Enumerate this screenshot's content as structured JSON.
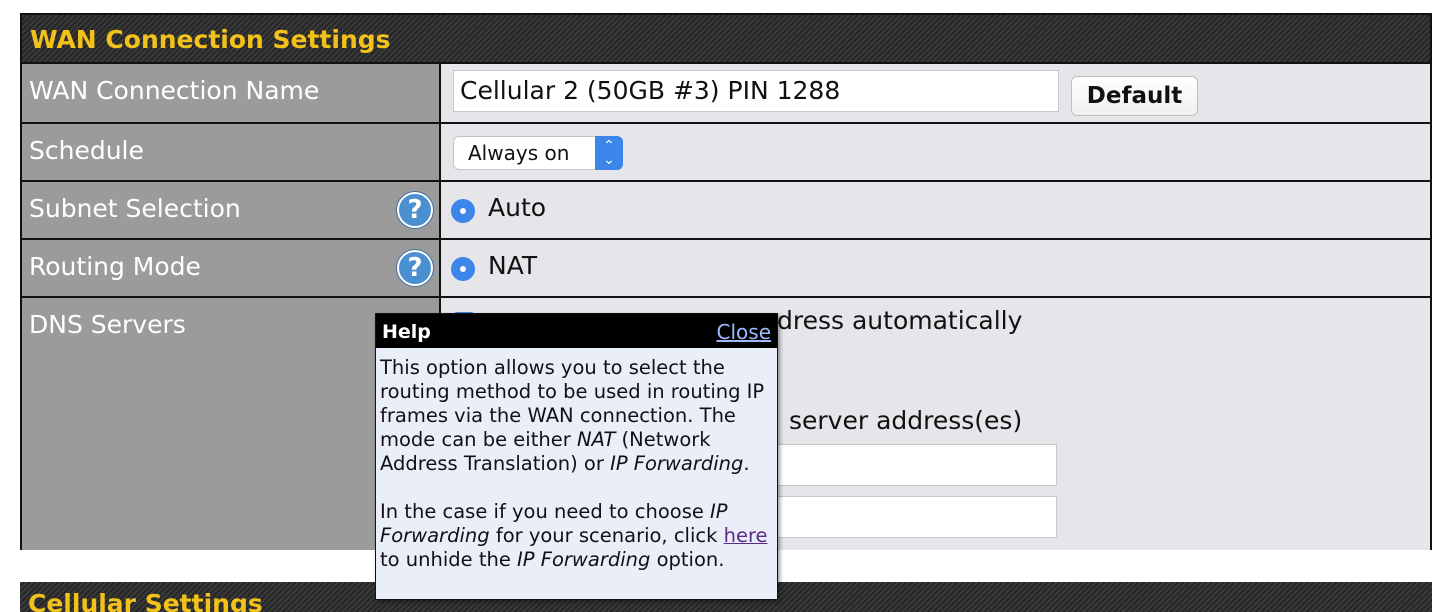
{
  "panel": {
    "title": "WAN Connection Settings"
  },
  "rows": {
    "name": {
      "label": "WAN Connection Name",
      "value": "Cellular 2 (50GB #3) PIN 1288",
      "button": "Default"
    },
    "schedule": {
      "label": "Schedule",
      "selected": "Always on"
    },
    "subnet": {
      "label": "Subnet Selection",
      "option": "Auto"
    },
    "routing": {
      "label": "Routing Mode",
      "option": "NAT"
    },
    "dns": {
      "label": "DNS Servers",
      "auto_text": "Obtain DNS server address automatically",
      "auto_visible": "dress automatically",
      "manual_visible": "server address(es)"
    }
  },
  "next_section": {
    "title": "Cellular Settings"
  },
  "help": {
    "title": "Help",
    "close": "Close",
    "p1_a": "This option allows you to select the routing method to be used in routing IP frames via the WAN connection. The mode can be either ",
    "p1_nat": "NAT",
    "p1_b": " (Network Address Translation) or ",
    "p1_ipf": "IP Forwarding",
    "p1_c": ".",
    "p2_a": "In the case if you need to choose ",
    "p2_ipf": "IP Forwarding",
    "p2_b": " for your scenario, click ",
    "p2_link": "here",
    "p2_c": " to unhide the ",
    "p2_ipf2": "IP Forwarding",
    "p2_d": " option."
  },
  "colors": {
    "header_text": "#f2c21a",
    "label_bg": "#9b9b9b",
    "accent": "#3b86e8"
  }
}
